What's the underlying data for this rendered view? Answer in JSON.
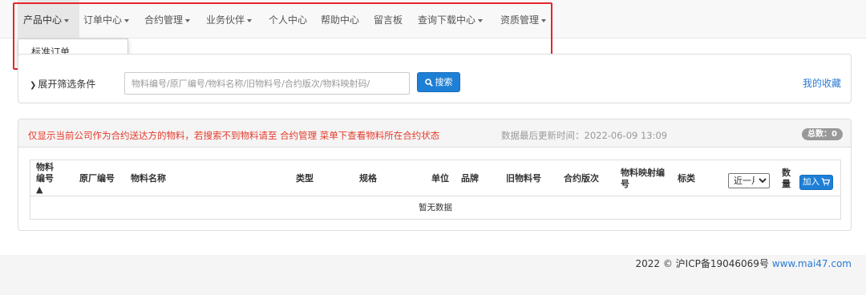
{
  "nav": {
    "items": [
      {
        "label": "产品中心",
        "caret": true
      },
      {
        "label": "订单中心",
        "caret": true
      },
      {
        "label": "合约管理",
        "caret": true
      },
      {
        "label": "业务伙伴",
        "caret": true
      },
      {
        "label": "个人中心",
        "caret": false
      },
      {
        "label": "帮助中心",
        "caret": false
      },
      {
        "label": "留言板",
        "caret": false
      },
      {
        "label": "查询下载中心",
        "caret": true
      },
      {
        "label": "资质管理",
        "caret": true
      }
    ],
    "dropdown": {
      "item": "标准订单"
    },
    "highlight_color": "#e5262b"
  },
  "filter": {
    "toggle_label": "展开筛选条件",
    "search_placeholder": "物料编号/原厂编号/物料名称/旧物料号/合约版次/物料映射码/",
    "search_button": "搜索",
    "favorites_link": "我的收藏"
  },
  "results": {
    "notice": "仅显示当前公司作为合约送达方的物料，若搜索不到物料请至 合约管理 菜单下查看物料所在合约状态",
    "updated": "数据最后更新时间：2022-06-09 13:09",
    "total_badge": "总数：0",
    "columns": {
      "material_no": "物料编号▲",
      "factory_no": "原厂编号",
      "material_name": "物料名称",
      "type": "类型",
      "spec": "规格",
      "unit": "单位",
      "brand": "品牌",
      "old_no": "旧物料号",
      "contract_version": "合约版次",
      "mapping_code": "物料映射编号",
      "category": "标类",
      "quantity": "数量"
    },
    "period_select": "近一月",
    "add_cart_button": "加入",
    "empty_text": "暂无数据"
  },
  "footer": {
    "text": "2022 © 沪ICP备19046069号",
    "link": "www.mai47.com"
  },
  "colors": {
    "primary": "#1e7fd6",
    "link": "#2a7ad5",
    "notice": "#e53b2c",
    "badge": "#999999"
  }
}
